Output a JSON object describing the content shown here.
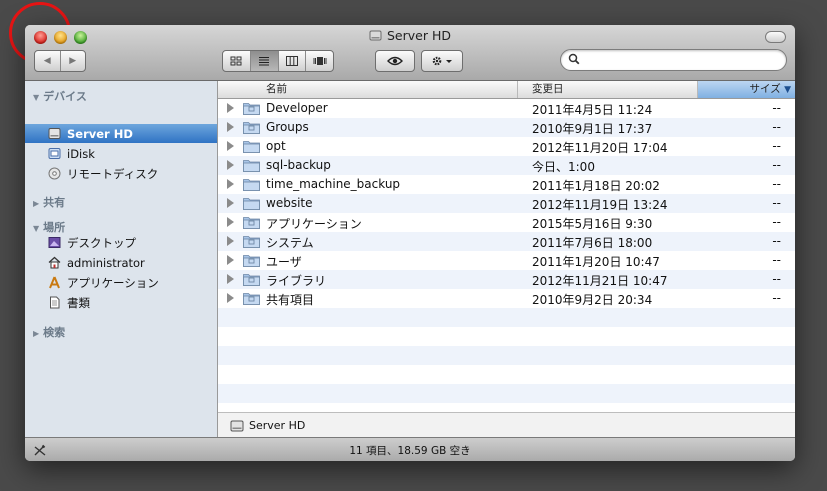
{
  "window": {
    "title": "Server HD"
  },
  "toolbar": {
    "back_glyph": "◀",
    "forward_glyph": "▶",
    "search_placeholder": "",
    "view_modes": [
      "icon",
      "list",
      "column",
      "coverflow"
    ],
    "active_view": "list"
  },
  "sidebar": {
    "devices_header": "デバイス",
    "shared_header": "共有",
    "places_header": "場所",
    "search_header": "検索",
    "devices": [
      {
        "label": "Server HD",
        "icon": "harddisk-icon",
        "selected": true
      },
      {
        "label": "iDisk",
        "icon": "idisk-icon"
      },
      {
        "label": "リモートディスク",
        "icon": "remote-disc-icon"
      }
    ],
    "places": [
      {
        "label": "デスクトップ",
        "icon": "desktop-icon"
      },
      {
        "label": "administrator",
        "icon": "home-icon"
      },
      {
        "label": "アプリケーション",
        "icon": "applications-icon"
      },
      {
        "label": "書類",
        "icon": "documents-icon"
      }
    ]
  },
  "columns": {
    "name": "名前",
    "date": "変更日",
    "size": "サイズ"
  },
  "files": [
    {
      "name": "Developer",
      "date": "2011年4月5日 11:24",
      "size": "--",
      "icon": "special-folder"
    },
    {
      "name": "Groups",
      "date": "2010年9月1日 17:37",
      "size": "--",
      "icon": "special-folder"
    },
    {
      "name": "opt",
      "date": "2012年11月20日 17:04",
      "size": "--",
      "icon": "folder"
    },
    {
      "name": "sql-backup",
      "date": "今日、1:00",
      "size": "--",
      "icon": "folder"
    },
    {
      "name": "time_machine_backup",
      "date": "2011年1月18日 20:02",
      "size": "--",
      "icon": "folder"
    },
    {
      "name": "website",
      "date": "2012年11月19日 13:24",
      "size": "--",
      "icon": "folder"
    },
    {
      "name": "アプリケーション",
      "date": "2015年5月16日 9:30",
      "size": "--",
      "icon": "special-folder"
    },
    {
      "name": "システム",
      "date": "2011年7月6日 18:00",
      "size": "--",
      "icon": "special-folder"
    },
    {
      "name": "ユーザ",
      "date": "2011年1月20日 10:47",
      "size": "--",
      "icon": "special-folder"
    },
    {
      "name": "ライブラリ",
      "date": "2012年11月21日 10:47",
      "size": "--",
      "icon": "special-folder"
    },
    {
      "name": "共有項目",
      "date": "2010年9月2日 20:34",
      "size": "--",
      "icon": "special-folder"
    }
  ],
  "pathbar": {
    "label": "Server HD"
  },
  "status": {
    "text": "11 項目、18.59 GB 空き"
  },
  "colors": {
    "selection": "#3d7fcc",
    "sidebar_bg": "#dde4ec",
    "alt_row": "#eef3fb",
    "annotation": "#e81414"
  }
}
